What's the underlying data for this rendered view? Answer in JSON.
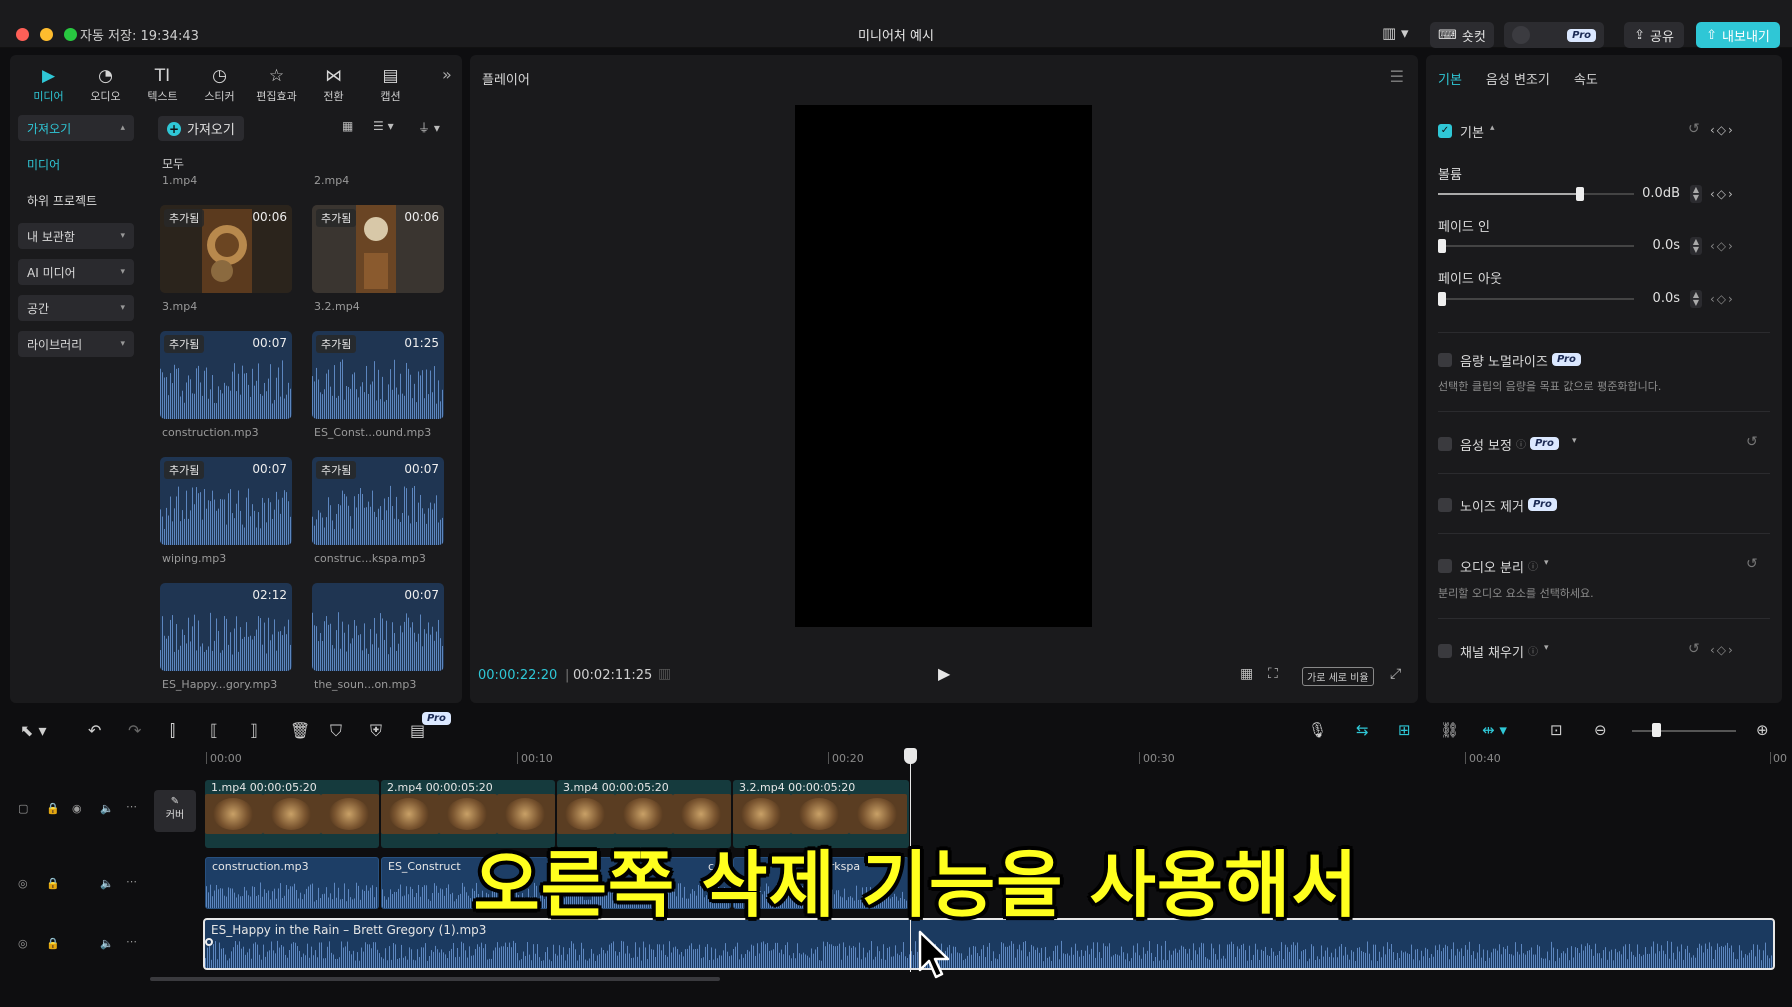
{
  "titlebar": {
    "autosave": "자동 저장: 19:34:43",
    "title": "미니어처 예시",
    "shortcut_label": "숏컷",
    "pro_label": "Pro",
    "share_label": "공유",
    "export_label": "내보내기"
  },
  "tool_tabs": [
    {
      "label": "미디어",
      "icon": "media-icon",
      "glyph": "▶"
    },
    {
      "label": "오디오",
      "icon": "audio-icon",
      "glyph": "◔"
    },
    {
      "label": "텍스트",
      "icon": "text-icon",
      "glyph": "TI"
    },
    {
      "label": "스티커",
      "icon": "sticker-icon",
      "glyph": "◷"
    },
    {
      "label": "편집효과",
      "icon": "effects-icon",
      "glyph": "☆"
    },
    {
      "label": "전환",
      "icon": "transition-icon",
      "glyph": "⋈"
    },
    {
      "label": "캡션",
      "icon": "caption-icon",
      "glyph": "▤"
    }
  ],
  "side_nav": [
    {
      "label": "가져오기"
    },
    {
      "label": "미디어"
    },
    {
      "label": "하위 프로젝트"
    },
    {
      "label": "내 보관함"
    },
    {
      "label": "AI 미디어"
    },
    {
      "label": "공간"
    },
    {
      "label": "라이브러리"
    }
  ],
  "media": {
    "import_label": "가져오기",
    "all_label": "모두",
    "added_label": "추가됨",
    "items": [
      {
        "name": "1.mp4",
        "duration": ""
      },
      {
        "name": "2.mp4",
        "duration": ""
      },
      {
        "name": "3.mp4",
        "duration": "00:06"
      },
      {
        "name": "3.2.mp4",
        "duration": "00:06"
      },
      {
        "name": "construction.mp3",
        "duration": "00:07"
      },
      {
        "name": "ES_Const...ound.mp3",
        "duration": "01:25"
      },
      {
        "name": "wiping.mp3",
        "duration": "00:07"
      },
      {
        "name": "construc...kspa.mp3",
        "duration": "00:07"
      },
      {
        "name": "ES_Happy...gory.mp3",
        "duration": "02:12"
      },
      {
        "name": "the_soun...on.mp3",
        "duration": "00:07"
      }
    ]
  },
  "player": {
    "title": "플레이어",
    "current_time": "00:00:22:20",
    "total_time": "00:02:11:25",
    "ratio_label": "가로 세로 비율"
  },
  "props": {
    "tabs": [
      "기본",
      "음성 변조기",
      "속도"
    ],
    "section_basic": "기본",
    "volume_label": "볼륨",
    "volume_value": "0.0dB",
    "fade_in_label": "페이드 인",
    "fade_in_value": "0.0s",
    "fade_out_label": "페이드 아웃",
    "fade_out_value": "0.0s",
    "normalize_label": "음량 노멀라이즈",
    "normalize_desc": "선택한 클립의 음량을 목표 값으로 평준화합니다.",
    "enhance_label": "음성 보정",
    "noise_label": "노이즈 제거",
    "separate_label": "오디오 분리",
    "separate_desc": "분리할 오디오 요소를 선택하세요.",
    "channel_label": "채널 채우기",
    "pro_label": "Pro"
  },
  "timeline": {
    "ticks": [
      "00:00",
      "00:10",
      "00:20",
      "00:30",
      "00:40",
      "00"
    ],
    "cover_label": "커버",
    "video_clips": [
      {
        "label": "1.mp4   00:00:05:20"
      },
      {
        "label": "2.mp4   00:00:05:20"
      },
      {
        "label": "3.mp4   00:00:05:20"
      },
      {
        "label": "3.2.mp4   00:00:05:20"
      }
    ],
    "audio_clips": [
      {
        "label": "construction.mp3"
      },
      {
        "label": "ES_Construct"
      },
      {
        "label": ""
      },
      {
        "label": "cor"
      },
      {
        "label": "workspa"
      }
    ],
    "music_clip": "ES_Happy in the Rain – Brett Gregory (1).mp3",
    "pro_label": "Pro"
  },
  "overlay": {
    "subtitle": "오른쪽 삭제 기능을 사용해서"
  },
  "colors": {
    "accent": "#2fc7d6",
    "subtitle": "#ffff1e",
    "audio_clip": "#1d3e66",
    "video_clip": "#153a3d"
  }
}
